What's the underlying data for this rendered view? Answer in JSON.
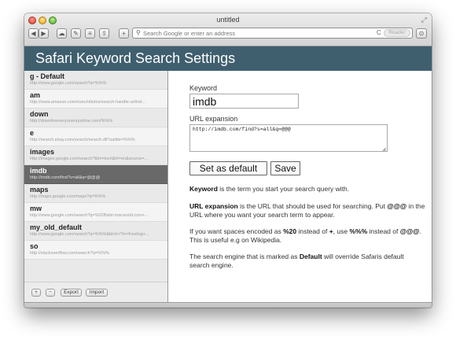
{
  "window": {
    "title": "untitled",
    "fullscreen_icon": "⤢"
  },
  "toolbar": {
    "back_glyph": "◀",
    "forward_glyph": "▶",
    "cloud_glyph": "☁",
    "wrench_glyph": "✎",
    "layers_glyph": "≡",
    "share_glyph": "⇪",
    "new_tab_glyph": "+",
    "search_glyph": "⚲",
    "reload_glyph": "C",
    "downloads_glyph": "⊙",
    "url_placeholder": "Search Google or enter an address",
    "reader_label": "Reader"
  },
  "header": {
    "title": "Safari Keyword Search Settings"
  },
  "sidebar": {
    "items": [
      {
        "name": "g - Default",
        "url": "http://www.google.com/search?q=%%%"
      },
      {
        "name": "am",
        "url": "http://www.amazon.com/exec/obidos/search-handle-url/ind..."
      },
      {
        "name": "down",
        "url": "http://downforeveryoneorjustme.com/%%%"
      },
      {
        "name": "e",
        "url": "http://search.ebay.com/search/search.dll?satitle=%%%"
      },
      {
        "name": "images",
        "url": "http://images.google.com/search?tbm=isch&hl=en&source=..."
      },
      {
        "name": "imdb",
        "url": "http://imdb.com/find?s=all&q=@@@"
      },
      {
        "name": "maps",
        "url": "http://maps.google.com/maps?q=%%%"
      },
      {
        "name": "mw",
        "url": "http://www.google.com/search?q=%22Bsite:macworld.com+..."
      },
      {
        "name": "my_old_default",
        "url": "http://www.google.com/search?q=%%%&btnI=/?m=Feeling+..."
      },
      {
        "name": "so",
        "url": "http://stackoverflow.com/search?q=%%%"
      }
    ],
    "selected_index": 5,
    "add_label": "+",
    "remove_label": "−",
    "export_label": "Export",
    "import_label": "Import"
  },
  "form": {
    "keyword_label": "Keyword",
    "keyword_value": "imdb",
    "url_label": "URL expansion",
    "url_value": "http://imdb.com/find?s=all&q=@@@",
    "set_default_label": "Set as default",
    "save_label": "Save"
  },
  "help": {
    "p1_b": "Keyword",
    "p1_t": " is the term you start your search query with.",
    "p2_b": "URL expansion",
    "p2_t1": " is the URL that should be used for searching. Put ",
    "p2_b2": "@@@",
    "p2_t2": " in the URL where you want your search term to appear.",
    "p3_t1": "If you want spaces encoded as ",
    "p3_b1": "%20",
    "p3_t2": " instead of ",
    "p3_b2": "+",
    "p3_t3": ", use ",
    "p3_b3": "%%%",
    "p3_t4": " instead of ",
    "p3_b4": "@@@",
    "p3_t5": ". This is useful e.g on Wikipedia.",
    "p4_t1": "The search engine that is marked as ",
    "p4_b": "Default",
    "p4_t2": " will override Safaris default search engine."
  }
}
